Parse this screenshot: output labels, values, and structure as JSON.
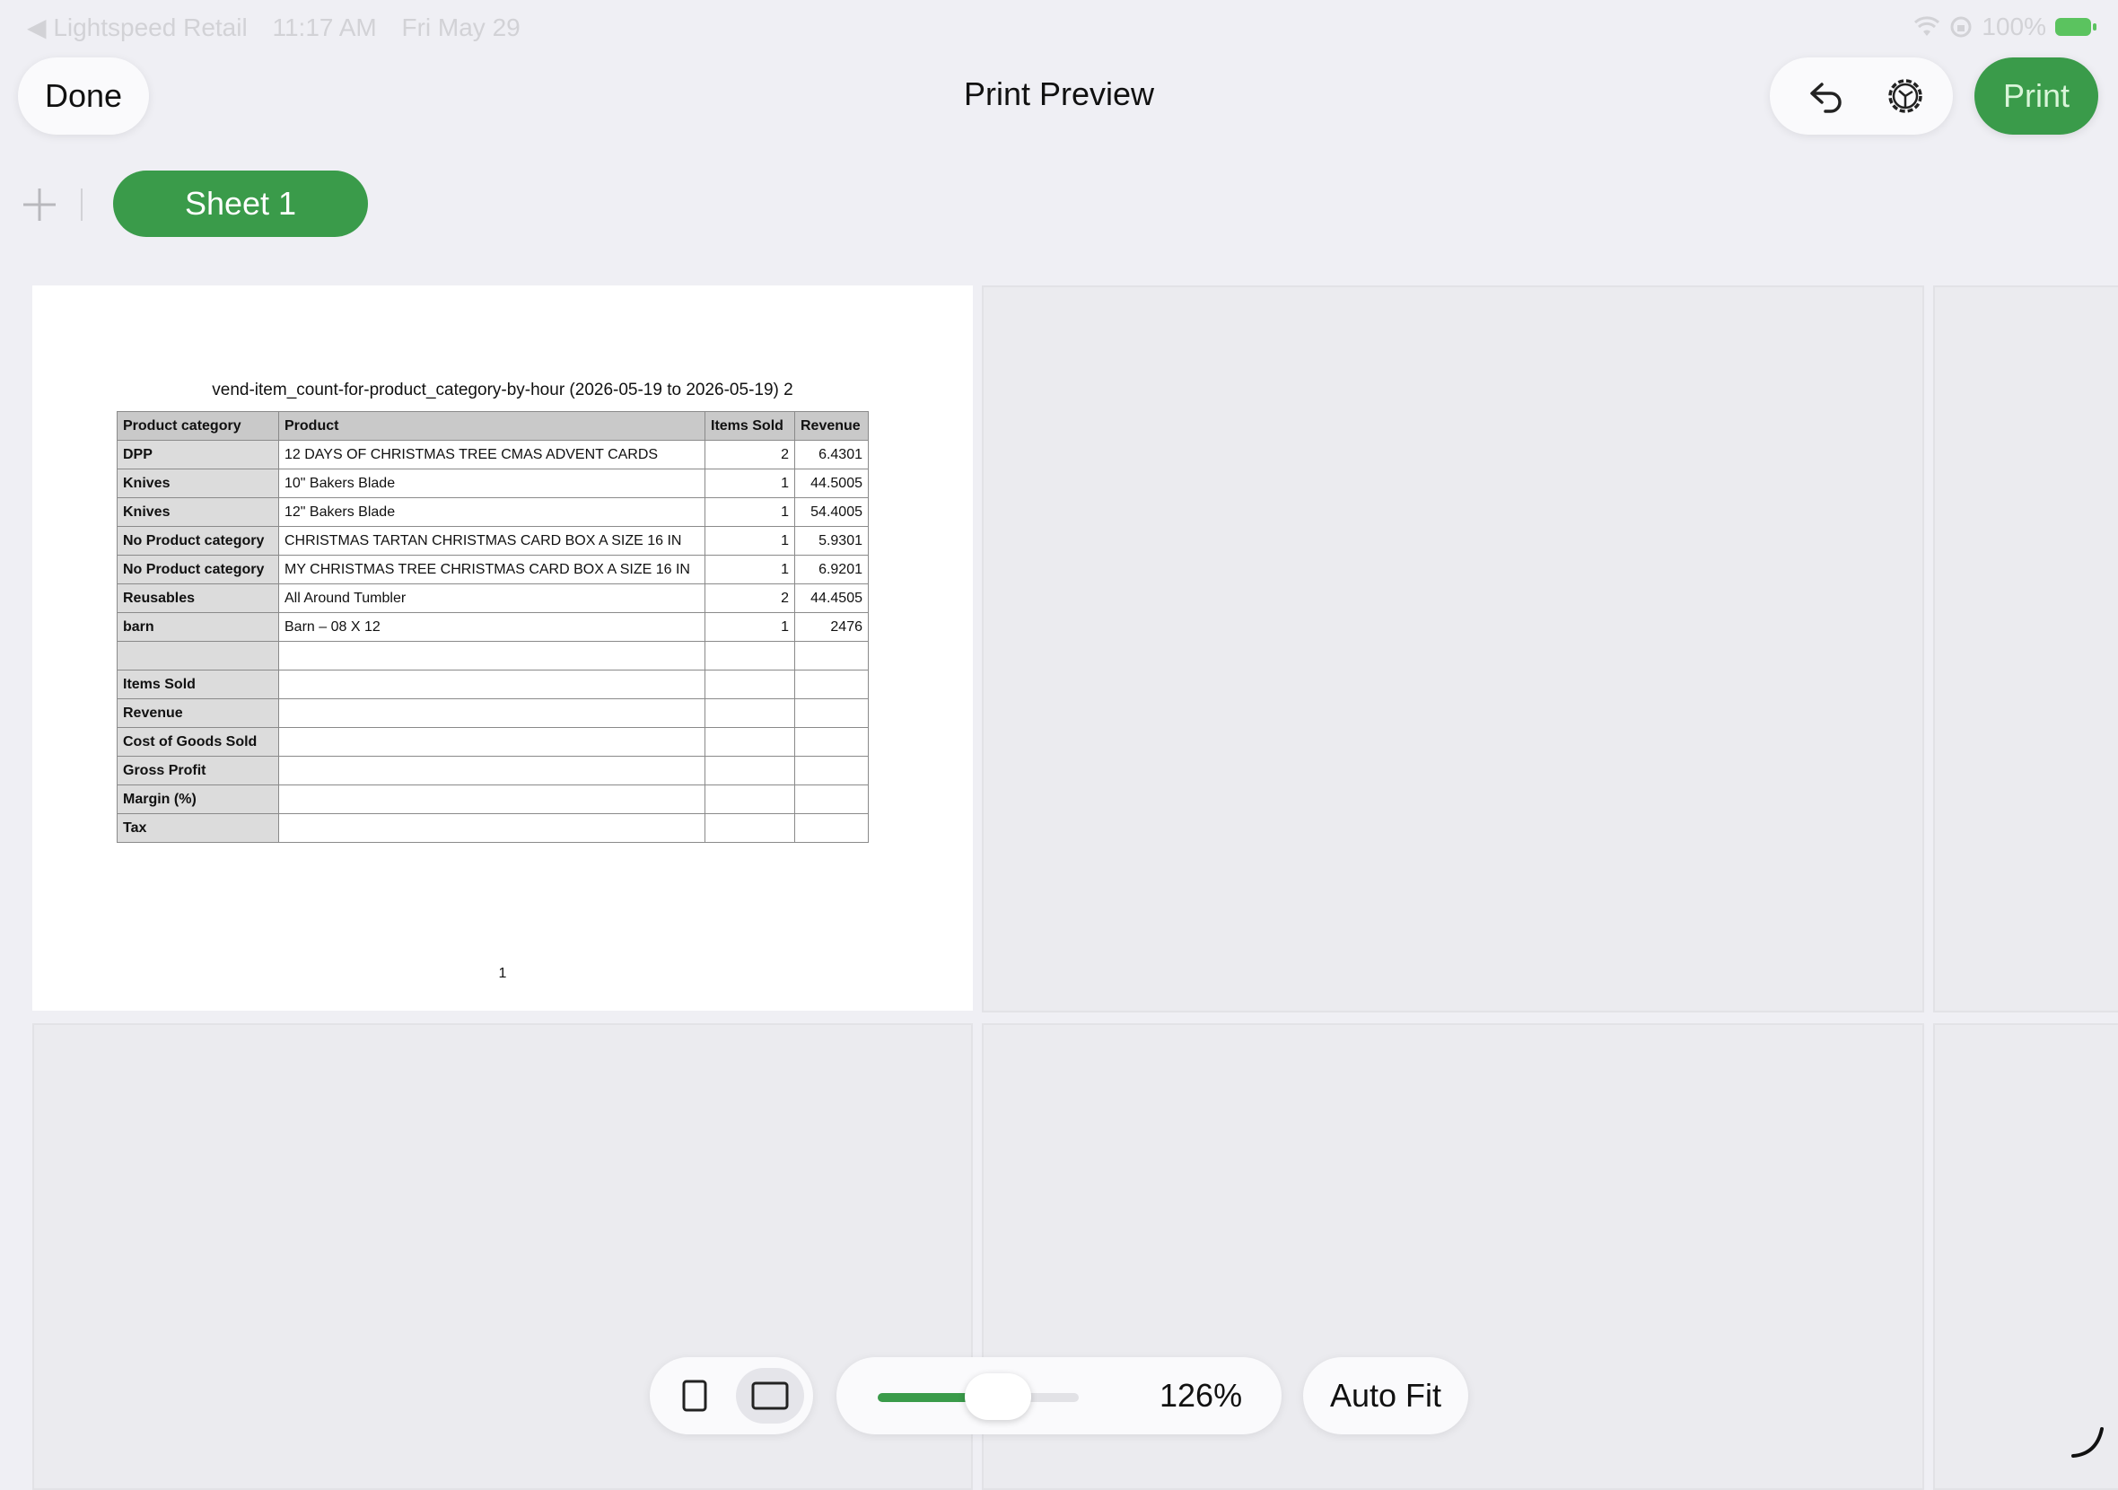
{
  "status_bar": {
    "back_app": "◀ Lightspeed Retail",
    "time": "11:17 AM",
    "date": "Fri May 29",
    "battery": "100%"
  },
  "header": {
    "done_label": "Done",
    "title": "Print Preview",
    "print_label": "Print"
  },
  "sheets": {
    "tabs": [
      {
        "label": "Sheet 1"
      }
    ]
  },
  "page": {
    "sheet_title": "vend-item_count-for-product_category-by-hour (2026-05-19 to 2026-05-19) 2",
    "columns": [
      "Product category",
      "Product",
      "Items Sold",
      "Revenue"
    ],
    "rows": [
      [
        "DPP",
        "12 DAYS OF CHRISTMAS TREE CMAS ADVENT CARDS",
        "2",
        "6.4301"
      ],
      [
        "Knives",
        "10\" Bakers Blade",
        "1",
        "44.5005"
      ],
      [
        "Knives",
        "12\" Bakers Blade",
        "1",
        "54.4005"
      ],
      [
        "No Product category",
        "CHRISTMAS TARTAN CHRISTMAS CARD BOX A SIZE 16 IN",
        "1",
        "5.9301"
      ],
      [
        "No Product category",
        "MY CHRISTMAS TREE CHRISTMAS CARD BOX A SIZE 16 IN",
        "1",
        "6.9201"
      ],
      [
        "Reusables",
        "All Around Tumbler",
        "2",
        "44.4505"
      ],
      [
        "barn",
        "Barn – 08 X 12",
        "1",
        "2476"
      ],
      [
        "",
        "",
        "",
        ""
      ],
      [
        "Items Sold",
        "",
        "",
        ""
      ],
      [
        "Revenue",
        "",
        "",
        ""
      ],
      [
        "Cost of Goods Sold",
        "",
        "",
        ""
      ],
      [
        "Gross Profit",
        "",
        "",
        ""
      ],
      [
        "Margin (%)",
        "",
        "",
        ""
      ],
      [
        "Tax",
        "",
        "",
        ""
      ]
    ],
    "page_number": "1"
  },
  "controls": {
    "zoom_percent": "126%",
    "zoom_fraction": 0.6,
    "autofit_label": "Auto Fit",
    "orientation": "landscape"
  },
  "colors": {
    "accent_green": "#3a9b4a",
    "background": "#efeff4"
  }
}
